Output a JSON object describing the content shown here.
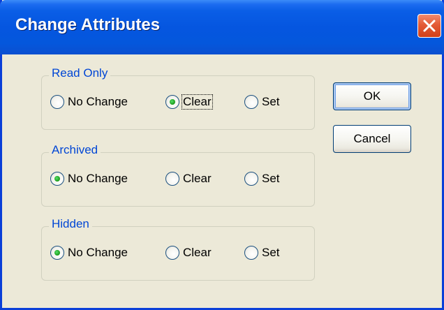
{
  "window": {
    "title": "Change Attributes"
  },
  "icons": {
    "close": "close-icon"
  },
  "groups": [
    {
      "title": "Read Only",
      "selected": "Clear",
      "options": [
        "No Change",
        "Clear",
        "Set"
      ]
    },
    {
      "title": "Archived",
      "selected": "No Change",
      "options": [
        "No Change",
        "Clear",
        "Set"
      ]
    },
    {
      "title": "Hidden",
      "selected": "No Change",
      "options": [
        "No Change",
        "Clear",
        "Set"
      ]
    }
  ],
  "buttons": {
    "ok": "OK",
    "cancel": "Cancel"
  },
  "colors": {
    "titlebar": "#0556e0",
    "close_button": "#e35b36",
    "group_title": "#0046d5",
    "dialog_background": "#ece9d8",
    "radio_check": "#21a121"
  }
}
